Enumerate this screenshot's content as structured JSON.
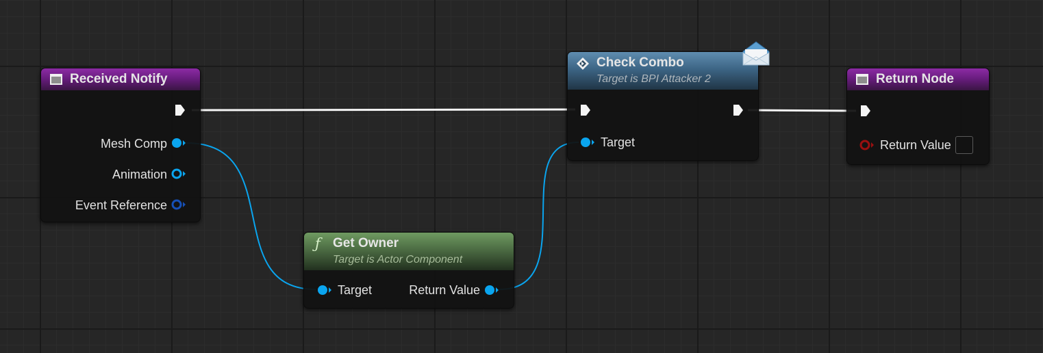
{
  "nodes": {
    "received_notify": {
      "title": "Received Notify",
      "pins": {
        "mesh_comp": "Mesh Comp",
        "animation": "Animation",
        "event_reference": "Event Reference"
      }
    },
    "check_combo": {
      "title": "Check Combo",
      "subtitle": "Target is BPI Attacker 2",
      "pins": {
        "target": "Target"
      },
      "badge_icon": "envelope-icon"
    },
    "return_node": {
      "title": "Return Node",
      "pins": {
        "return_value": "Return Value"
      },
      "return_value_checked": false
    },
    "get_owner": {
      "title": "Get Owner",
      "subtitle": "Target is Actor Component",
      "pins": {
        "target": "Target",
        "return_value": "Return Value"
      },
      "icon": "function-icon"
    }
  },
  "colors": {
    "graph_background": "#262626",
    "event_header": "#6a1d80",
    "message_header": "#3d6585",
    "pure_function_header": "#4c6c43",
    "object_pin": "#0aa5ef",
    "boolean_pin": "#9a1010",
    "exec_wire": "#ffffff"
  }
}
